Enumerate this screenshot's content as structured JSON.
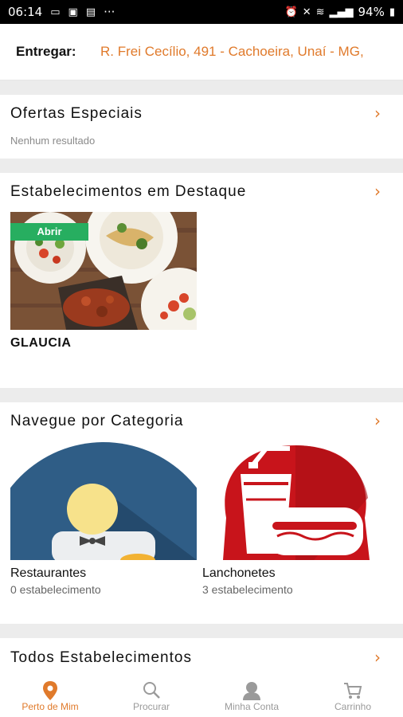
{
  "status_bar": {
    "time": "06:14",
    "dots": "···",
    "battery": "94%"
  },
  "delivery": {
    "label": "Entregar:",
    "address": "R. Frei Cecílio, 491 - Cachoeira, Unaí - MG,"
  },
  "special_offers": {
    "title": "Ofertas Especiais",
    "empty_text": "Nenhum resultado"
  },
  "featured": {
    "title": "Estabelecimentos em Destaque",
    "items": [
      {
        "name": "GLAUCIA",
        "badge": "Abrir"
      }
    ]
  },
  "categories": {
    "title": "Navegue por Categoria",
    "items": [
      {
        "name": "Restaurantes",
        "count": "0 estabelecimento"
      },
      {
        "name": "Lanchonetes",
        "count": "3 estabelecimento"
      }
    ]
  },
  "all_stores": {
    "title": "Todos Estabelecimentos"
  },
  "bottom_nav": {
    "items": [
      {
        "label": "Perto de Mim",
        "icon": "location-pin-icon",
        "active": true
      },
      {
        "label": "Procurar",
        "icon": "search-icon",
        "active": false
      },
      {
        "label": "Minha Conta",
        "icon": "user-icon",
        "active": false
      },
      {
        "label": "Carrinho",
        "icon": "cart-icon",
        "active": false
      }
    ]
  },
  "colors": {
    "accent": "#e07a2b",
    "badge_green": "#27ae60",
    "separator": "#ececec"
  }
}
